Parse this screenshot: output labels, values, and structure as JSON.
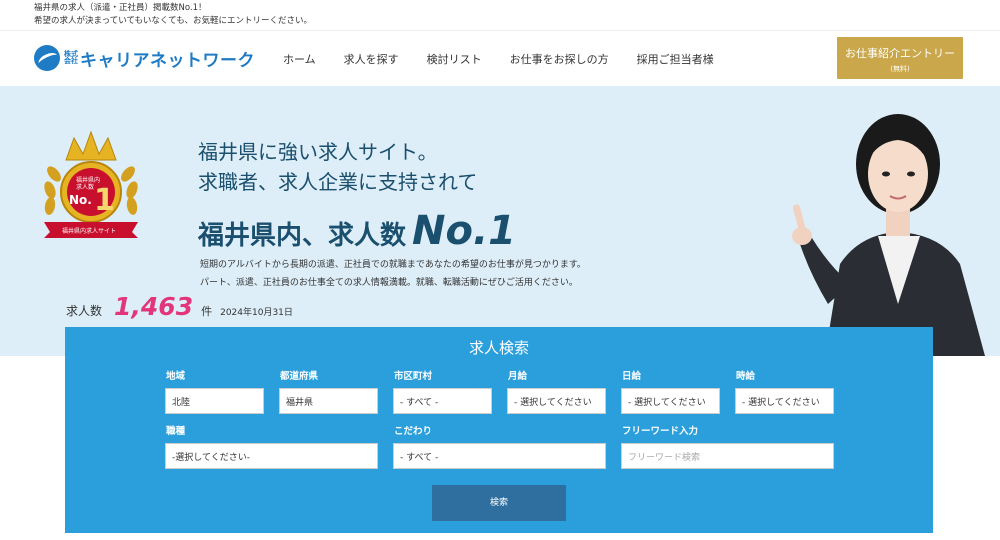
{
  "topbar": {
    "line1": "福井県の求人（派遣・正社員）掲載数No.1！",
    "line2": "希望の求人が決まっていてもいなくても、お気軽にエントリーください。"
  },
  "header": {
    "logo_kabu": "株式会社",
    "logo_text": "キャリアネットワーク",
    "nav": [
      "ホーム",
      "求人を探す",
      "検討リスト",
      "お仕事をお探しの方",
      "採用ご担当者様"
    ],
    "entry_main": "お仕事紹介エントリー",
    "entry_sub": "(無料)"
  },
  "hero": {
    "badge_text1": "福井県内",
    "badge_text2": "求人数",
    "badge_no": "No.",
    "badge_one": "1",
    "badge_ribbon": "福井県内求人サイト",
    "line1": "福井県に強い求人サイト。",
    "line2": "求職者、求人企業に支持されて",
    "line3": "福井県内、求人数",
    "no1": "No.1",
    "desc1": "短期のアルバイトから長期の派遣、正社員での就職まであなたの希望のお仕事が見つかります。",
    "desc2": "パート、派遣、正社員のお仕事全ての求人情報満載。就職、転職活動にぜひご活用ください。",
    "count_label": "求人数",
    "count_value": "1,463",
    "count_unit": "件",
    "count_date": "2024年10月31日"
  },
  "search": {
    "title": "求人検索",
    "labels": {
      "area": "地域",
      "pref": "都道府県",
      "city": "市区町村",
      "monthly": "月給",
      "daily": "日給",
      "hourly": "時給",
      "job": "職種",
      "kodawari": "こだわり",
      "freeword": "フリーワード入力"
    },
    "values": {
      "area": "北陸",
      "pref": "福井県",
      "city": "- すべて -",
      "monthly": "- 選択してください",
      "daily": "- 選択してください",
      "hourly": "- 選択してください",
      "job": "-選択してください-",
      "kodawari": "- すべて -"
    },
    "freeword_placeholder": "フリーワード検索",
    "button": "検索"
  },
  "colors": {
    "brand": "#1e7bc4",
    "gold": "#c9a74a",
    "hero_bg": "#ddeef8",
    "search_bg": "#2a9fdb",
    "count_pink": "#e2357a"
  }
}
